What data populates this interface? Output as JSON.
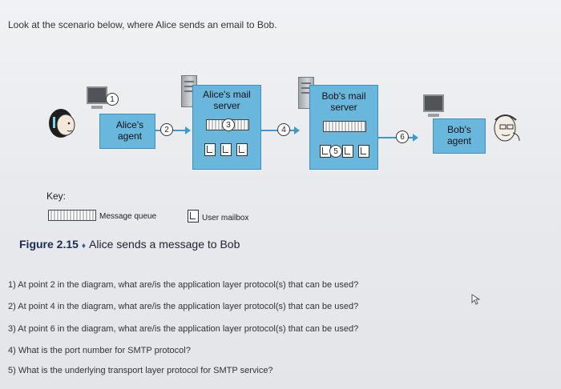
{
  "intro": "Look at the scenario below, where Alice sends an email to Bob.",
  "figure": {
    "alice_agent": "Alice's agent",
    "alice_server": "Alice's mail server",
    "bob_server": "Bob's mail server",
    "bob_agent": "Bob's agent",
    "points": [
      "1",
      "2",
      "3",
      "4",
      "5",
      "6"
    ],
    "key_title": "Key:",
    "key_queue": "Message queue",
    "key_mailbox": "User mailbox",
    "caption_number": "Figure 2.15",
    "caption_separator": "♦",
    "caption_text": "Alice sends a message to Bob",
    "accent_color": "#6ab7de",
    "arrow_color": "#3a9bd0"
  },
  "questions": [
    "1) At point 2 in the diagram, what are/is the application layer protocol(s) that can be used?",
    "2) At point 4 in the diagram, what are/is the application layer protocol(s) that can be used?",
    "3) At point 6 in the diagram, what are/is the application layer protocol(s) that can be used?",
    "4) What is the port number for SMTP protocol?",
    "5) What is the underlying transport layer protocol for SMTP service?"
  ]
}
